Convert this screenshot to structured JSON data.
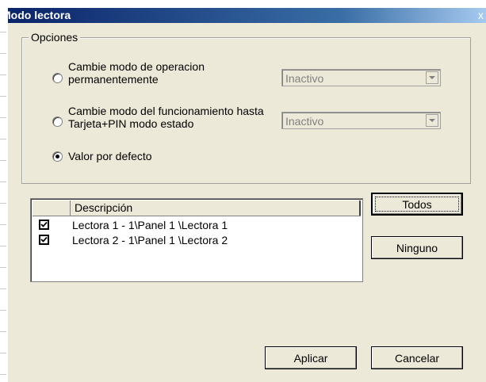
{
  "window": {
    "title": "Modo lectora",
    "close_glyph": "x"
  },
  "options": {
    "legend": "Opciones",
    "radio1": {
      "label_line1": "Cambie modo de operacion",
      "label_line2": "permanentemente",
      "checked": false
    },
    "combo1": {
      "value": "Inactivo"
    },
    "radio2": {
      "label_line1": "Cambie modo del funcionamiento hasta",
      "label_line2": "Tarjeta+PIN modo estado",
      "checked": false
    },
    "combo2": {
      "value": "Inactivo"
    },
    "radio3": {
      "label": "Valor por defecto",
      "checked": true
    }
  },
  "readers": {
    "column_header": "Descripción",
    "rows": [
      {
        "label": "Lectora  1 - 1\\Panel  1 \\Lectora  1",
        "checked": true
      },
      {
        "label": "Lectora  2 - 1\\Panel  1 \\Lectora  2",
        "checked": true
      }
    ]
  },
  "buttons": {
    "all": "Todos",
    "none": "Ninguno",
    "apply": "Aplicar",
    "cancel": "Cancelar"
  }
}
